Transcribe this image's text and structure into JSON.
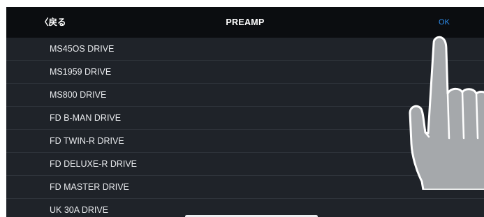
{
  "navbar": {
    "back_label": "〈戻る",
    "title": "PREAMP",
    "ok_label": "OK"
  },
  "preamp_list": [
    "MS45OS DRIVE",
    "MS1959 DRIVE",
    "MS800 DRIVE",
    "FD B-MAN DRIVE",
    "FD TWIN-R DRIVE",
    "FD DELUXE-R DRIVE",
    "FD MASTER DRIVE",
    "UK 30A DRIVE"
  ],
  "colors": {
    "navbar_bg": "#0b0d10",
    "list_bg": "#1f2329",
    "ok_accent": "#2d8ff0",
    "hand_fill": "#a5a8ab"
  },
  "icons": {
    "pointer": "pointing-hand-icon"
  }
}
